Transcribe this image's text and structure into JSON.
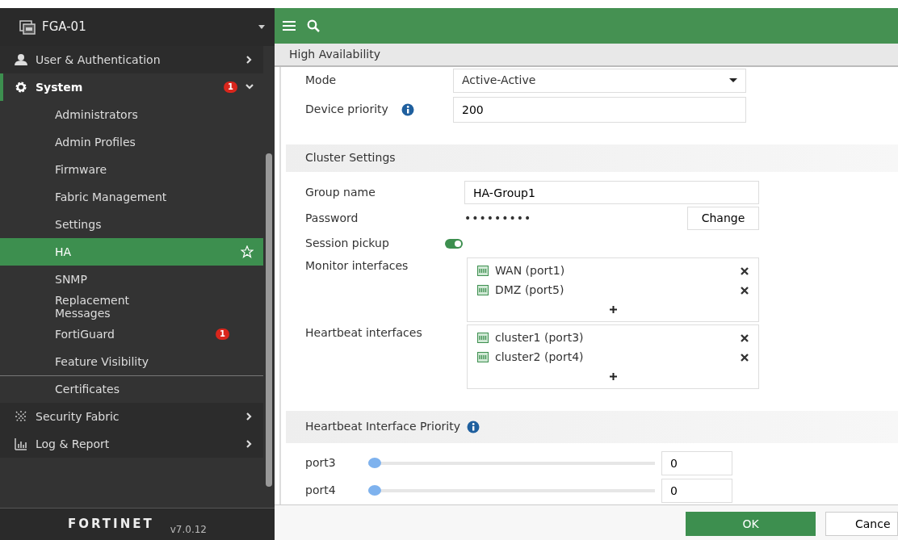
{
  "sidebar": {
    "device": "FGA-01",
    "items": [
      {
        "label": "User & Authentication",
        "expanded": false
      },
      {
        "label": "System",
        "expanded": true,
        "badge": "1",
        "children": [
          {
            "label": "Administrators",
            "selected": false
          },
          {
            "label": "Admin Profiles",
            "selected": false
          },
          {
            "label": "Firmware",
            "selected": false
          },
          {
            "label": "Fabric Management",
            "selected": false
          },
          {
            "label": "Settings",
            "selected": false
          },
          {
            "label": "HA",
            "selected": true
          },
          {
            "label": "SNMP",
            "selected": false
          },
          {
            "label": "Replacement Messages",
            "selected": false
          },
          {
            "label": "FortiGuard",
            "selected": false,
            "badge": "1"
          },
          {
            "label": "Feature Visibility",
            "selected": false
          },
          {
            "label": "Certificates",
            "selected": false,
            "divider_before": true
          }
        ]
      },
      {
        "label": "Security Fabric",
        "expanded": false
      },
      {
        "label": "Log & Report",
        "expanded": false
      }
    ],
    "logo": "FORTINET",
    "version": "v7.0.12"
  },
  "page_title": "High Availability",
  "mode": {
    "label": "Mode",
    "value": "Active-Active"
  },
  "device_priority": {
    "label": "Device priority",
    "value": "200"
  },
  "cluster_settings": {
    "title": "Cluster Settings",
    "group_name": {
      "label": "Group name",
      "value": "HA-Group1"
    },
    "password": {
      "label": "Password",
      "value": "•••••••••",
      "button": "Change"
    },
    "session_pickup": {
      "label": "Session pickup",
      "on": true
    },
    "interface_lists": [
      {
        "label": "Monitor interfaces",
        "items": [
          "WAN (port1)",
          "DMZ (port5)"
        ]
      },
      {
        "label": "Heartbeat interfaces",
        "items": [
          "cluster1 (port3)",
          "cluster2 (port4)"
        ]
      }
    ]
  },
  "heartbeat_priority": {
    "title": "Heartbeat Interface Priority",
    "ports": [
      {
        "name": "port3",
        "level": 0,
        "value": "0"
      },
      {
        "name": "port4",
        "level": 0,
        "value": "0"
      }
    ]
  },
  "buttons": [
    "OK",
    "Cance"
  ]
}
